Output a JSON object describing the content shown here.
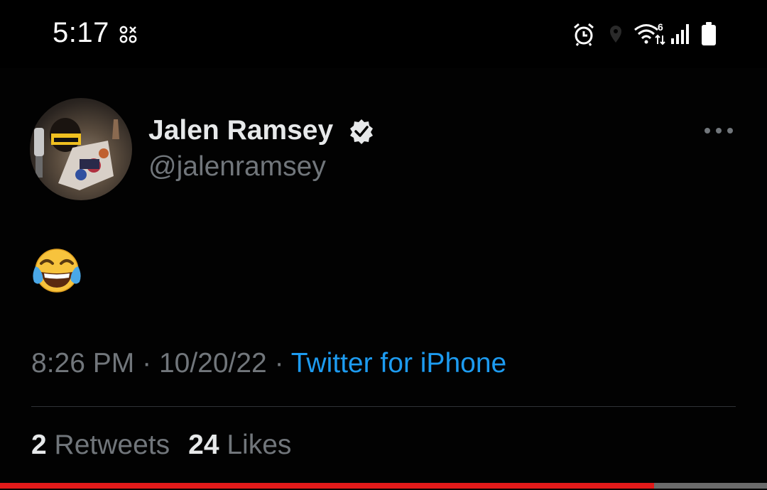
{
  "status_bar": {
    "time": "5:17",
    "left_icon": "app-notification-icon",
    "right_icons": [
      "alarm-icon",
      "location-icon",
      "wifi-6-icon",
      "signal-icon",
      "battery-icon"
    ]
  },
  "tweet": {
    "display_name": "Jalen Ramsey",
    "handle": "@jalenramsey",
    "verified": true,
    "text_emoji": "face-with-tears-of-joy-emoji",
    "time": "8:26 PM",
    "separator": "·",
    "date": "10/20/22",
    "source": "Twitter for iPhone",
    "retweets_count": "2",
    "retweets_label": "Retweets",
    "likes_count": "24",
    "likes_label": "Likes"
  },
  "video_progress": {
    "fraction": 0.853
  },
  "colors": {
    "background": "#000000",
    "primary_text": "#e7e9ea",
    "secondary_text": "#71767b",
    "link": "#1d9bf0",
    "progress": "#e21a1a",
    "divider": "#2f3336"
  }
}
